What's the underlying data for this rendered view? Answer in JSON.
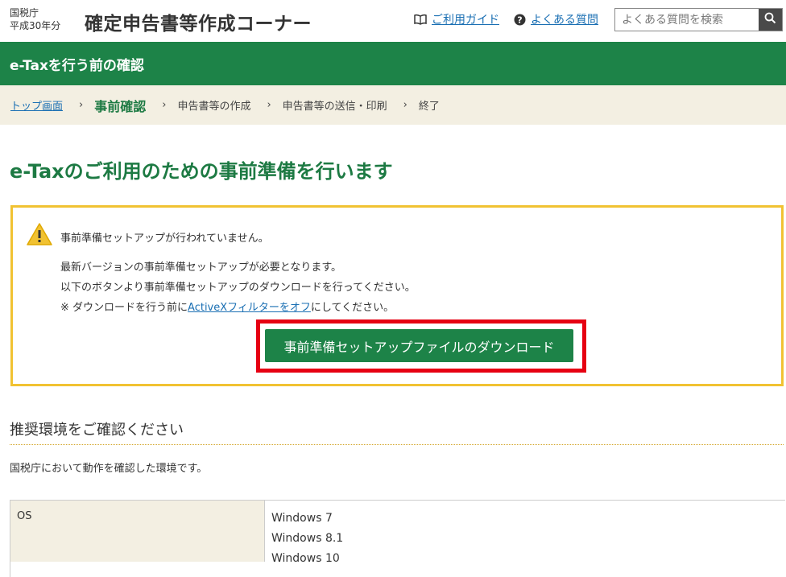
{
  "header": {
    "agency_name": "国税庁",
    "agency_year": "平成30年分",
    "site_title": "確定申告書等作成コーナー",
    "guide_link": "ご利用ガイド",
    "faq_link": "よくある質問",
    "search_placeholder": "よくある質問を検索"
  },
  "greenbar": {
    "title": "e-Taxを行う前の確認"
  },
  "breadcrumb": {
    "items": [
      "トップ画面",
      "事前確認",
      "申告書等の作成",
      "申告書等の送信・印刷",
      "終了"
    ],
    "separator": "›"
  },
  "page_title": "e-Taxのご利用のための事前準備を行います",
  "notice": {
    "warning": "事前準備セットアップが行われていません。",
    "line1": "最新バージョンの事前準備セットアップが必要となります。",
    "line2": "以下のボタンより事前準備セットアップのダウンロードを行ってください。",
    "note_prefix": "※ ダウンロードを行う前に",
    "note_link": "ActiveXフィルターをオフ",
    "note_suffix": "にしてください。",
    "download_button": "事前準備セットアップファイルのダウンロード"
  },
  "recommended": {
    "title": "推奨環境をご確認ください",
    "description": "国税庁において動作を確認した環境です。",
    "os_label": "OS",
    "os_values": [
      "Windows 7",
      "Windows 8.1",
      "Windows 10"
    ]
  },
  "colors": {
    "brand_green": "#1d8348",
    "breadcrumb_bg": "#f3efe2",
    "notice_border": "#f1c232",
    "highlight_red": "#e60012",
    "link": "#1a6fb3"
  }
}
